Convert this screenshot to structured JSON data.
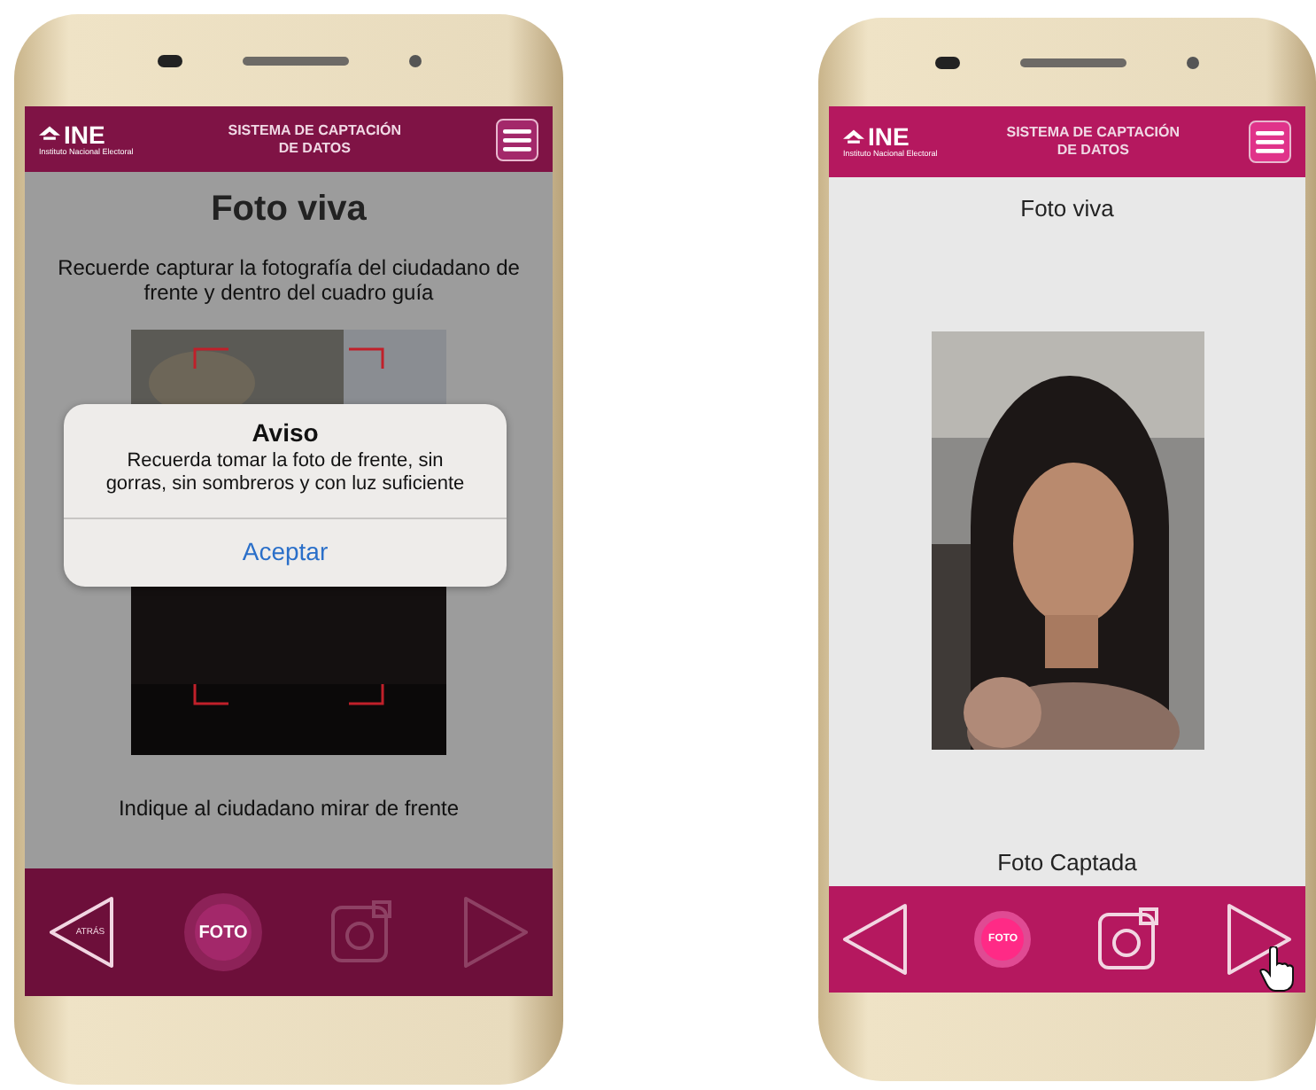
{
  "phones": [
    {
      "kind": "capture",
      "header": {
        "logo": "INE",
        "logo_subtitle": "Instituto Nacional Electoral",
        "title": "SISTEMA DE CAPTACIÓN DE DATOS"
      },
      "heading": "Foto viva",
      "instruction": "Recuerde capturar la fotografía del ciudadano de frente y dentro del cuadro guía",
      "footer_text": "Indique al ciudadano mirar de frente",
      "dialog": {
        "title": "Aviso",
        "message": "Recuerda tomar la foto de frente, sin gorras, sin sombreros y con luz suficiente",
        "button": "Aceptar"
      },
      "nav": {
        "back_label": "ATRÁS",
        "photo_label": "FOTO",
        "camera_enabled": false,
        "next_enabled": false
      },
      "pointer": false
    },
    {
      "kind": "review",
      "header": {
        "logo": "INE",
        "logo_subtitle": "Instituto Nacional Electoral",
        "title": "SISTEMA DE CAPTACIÓN DE DATOS"
      },
      "heading": "Foto viva",
      "caption": "Foto Captada",
      "nav": {
        "photo_label": "FOTO",
        "camera_enabled": true,
        "next_enabled": true
      },
      "pointer": true
    }
  ]
}
